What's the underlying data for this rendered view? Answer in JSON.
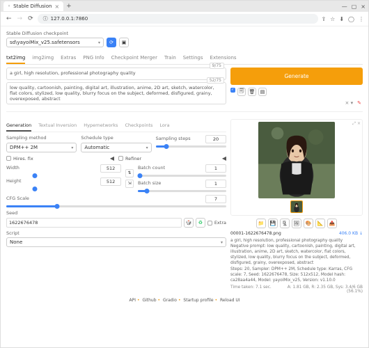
{
  "browser": {
    "tab_title": "Stable Diffusion",
    "url": "127.0.0.1:7860"
  },
  "checkpoint": {
    "label": "Stable Diffusion checkpoint",
    "value": "sd\\yayoiMix_v25.safetensors"
  },
  "tabs": [
    "txt2img",
    "img2img",
    "Extras",
    "PNG Info",
    "Checkpoint Merger",
    "Train",
    "Settings",
    "Extensions"
  ],
  "prompt": {
    "text": "a girl, high resolution, professional photography quality",
    "counter": "9/75"
  },
  "neg_prompt": {
    "text": "low quality, cartoonish, painting, digital art, illustration, anime, 2D art, sketch, watercolor, flat colors, stylized, low quality, blurry focus on the subject, deformed, disfigured, grainy, overexposed, abstract",
    "counter": "52/75"
  },
  "generate": "Generate",
  "subtabs": [
    "Generation",
    "Textual Inversion",
    "Hypernetworks",
    "Checkpoints",
    "Lora"
  ],
  "sampler": {
    "label": "Sampling method",
    "value": "DPM++ 2M"
  },
  "schedule": {
    "label": "Schedule type",
    "value": "Automatic"
  },
  "steps": {
    "label": "Sampling steps",
    "value": "20"
  },
  "hires": {
    "label": "Hires. fix"
  },
  "refiner": {
    "label": "Refiner"
  },
  "width": {
    "label": "Width",
    "value": "512"
  },
  "height": {
    "label": "Height",
    "value": "512"
  },
  "batch_count": {
    "label": "Batch count",
    "value": "1"
  },
  "batch_size": {
    "label": "Batch size",
    "value": "1"
  },
  "cfg": {
    "label": "CFG Scale",
    "value": "7"
  },
  "seed": {
    "label": "Seed",
    "value": "1622676478",
    "extra": "Extra"
  },
  "script": {
    "label": "Script",
    "value": "None"
  },
  "output": {
    "filename": "00001-1622676478.png",
    "size": "406.0 KB ↓",
    "prompt_line": "a girl, high resolution, professional photography quality",
    "neg_line": "Negative prompt: low quality, cartoonish, painting, digital art, illustration, anime, 2D art, sketch, watercolor, flat colors, stylized, low quality, blurry focus on the subject, deformed, disfigured, grainy, overexposed, abstract",
    "params": "Steps: 20, Sampler: DPM++ 2M, Schedule type: Karras, CFG scale: 7, Seed: 1622676478, Size: 512x512, Model hash: ca28aa4a44, Model: yayoiMix_v25, Version: v1.10.0",
    "time": "Time taken: 7.1 sec.",
    "stats": "A: 1.81 GB, R: 2.35 GB, Sys: 3.4/6 GB (56.1%)"
  },
  "footer": {
    "links": [
      "API",
      "Github",
      "Gradio",
      "Startup profile",
      "Reload UI"
    ]
  }
}
